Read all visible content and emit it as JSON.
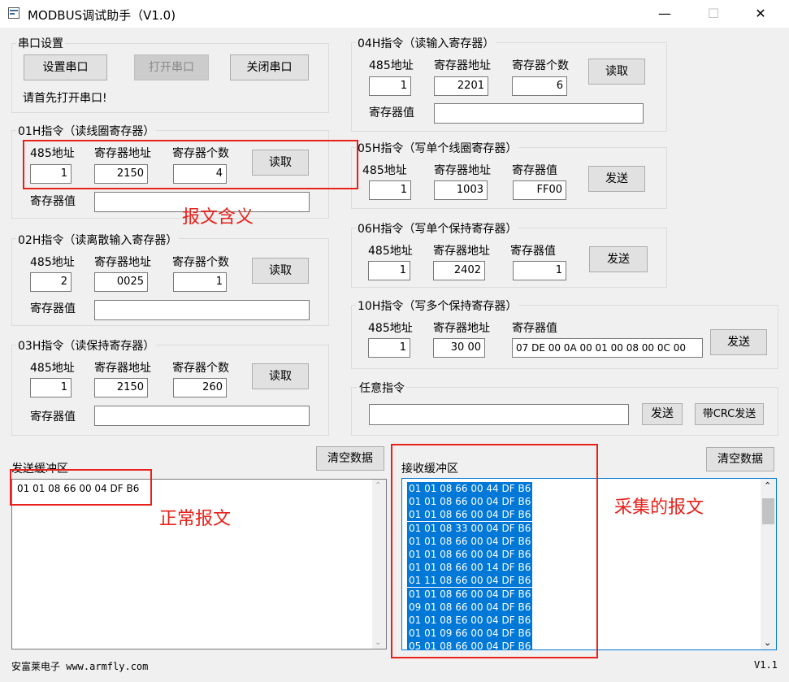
{
  "window": {
    "title": "MODBUS调试助手（V1.0)",
    "min": "—",
    "max": "☐",
    "close": "✕"
  },
  "serial": {
    "group": "串口设置",
    "setup_btn": "设置串口",
    "open_btn": "打开串口",
    "close_btn": "关闭串口",
    "status": "请首先打开串口!"
  },
  "g01": {
    "title": "01H指令（读线圈寄存器）",
    "addr_label": "485地址",
    "reg_label": "寄存器地址",
    "count_label": "寄存器个数",
    "addr": "1",
    "reg": "2150",
    "count": "4",
    "btn": "读取",
    "value_label": "寄存器值",
    "value": ""
  },
  "g02": {
    "title": "02H指令（读离散输入寄存器）",
    "addr_label": "485地址",
    "reg_label": "寄存器地址",
    "count_label": "寄存器个数",
    "addr": "2",
    "reg": "0025",
    "count": "1",
    "btn": "读取",
    "value_label": "寄存器值",
    "value": ""
  },
  "g03": {
    "title": "03H指令（读保持寄存器）",
    "addr_label": "485地址",
    "reg_label": "寄存器地址",
    "count_label": "寄存器个数",
    "addr": "1",
    "reg": "2150",
    "count": "260",
    "btn": "读取",
    "value_label": "寄存器值",
    "value": ""
  },
  "g04": {
    "title": "04H指令（读输入寄存器）",
    "addr_label": "485地址",
    "reg_label": "寄存器地址",
    "count_label": "寄存器个数",
    "addr": "1",
    "reg": "2201",
    "count": "6",
    "btn": "读取",
    "value_label": "寄存器值",
    "value": ""
  },
  "g05": {
    "title": "05H指令（写单个线圈寄存器）",
    "addr_label": "485地址",
    "reg_label": "寄存器地址",
    "val_label": "寄存器值",
    "addr": "1",
    "reg": "1003",
    "val": "FF00",
    "btn": "发送"
  },
  "g06": {
    "title": "06H指令（写单个保持寄存器）",
    "addr_label": "485地址",
    "reg_label": "寄存器地址",
    "val_label": "寄存器值",
    "addr": "1",
    "reg": "2402",
    "val": "1",
    "btn": "发送"
  },
  "g10": {
    "title": "10H指令（写多个保持寄存器）",
    "addr_label": "485地址",
    "reg_label": "寄存器地址",
    "val_label": "寄存器值",
    "addr": "1",
    "reg": "30 00",
    "val": "07 DE  00 0A  00 01  00 08  00 0C  00",
    "btn": "发送"
  },
  "any": {
    "title": "任意指令",
    "value": "",
    "send_btn": "发送",
    "crc_btn": "带CRC发送"
  },
  "send_buf": {
    "label": "发送缓冲区",
    "clear_btn": "清空数据",
    "content": "01 01 08 66 00 04 DF B6"
  },
  "recv_buf": {
    "label": "接收缓冲区",
    "clear_btn": "清空数据",
    "lines": [
      "01 01 08 66 00 44 DF B6",
      "01 01 08 66 00 04 DF B6",
      "01 01 08 66 00 04 DF B6",
      "01 01 08 33 00 04 DF B6",
      "01 01 08 66 00 04 DF B6",
      "01 01 08 66 00 04 DF B6",
      "01 01 08 66 00 14 DF B6",
      "01 11 08 66 00 04 DF B6",
      "01 01 08 66 00 04 DF B6",
      "09 01 08 66 00 04 DF B6",
      "01 01 08 E6 00 04 DF B6",
      "01 01 09 66 00 04 DF B6",
      "05 01 08 66 00 04 DF B6"
    ]
  },
  "annotations": {
    "meaning": "报文含义",
    "normal": "正常报文",
    "collected": "采集的报文"
  },
  "footer": {
    "company": "安富莱电子 www.armfly.com",
    "version": "V1.1"
  },
  "colors": {
    "annotation": "#e8221b",
    "selection": "#0078d7"
  }
}
